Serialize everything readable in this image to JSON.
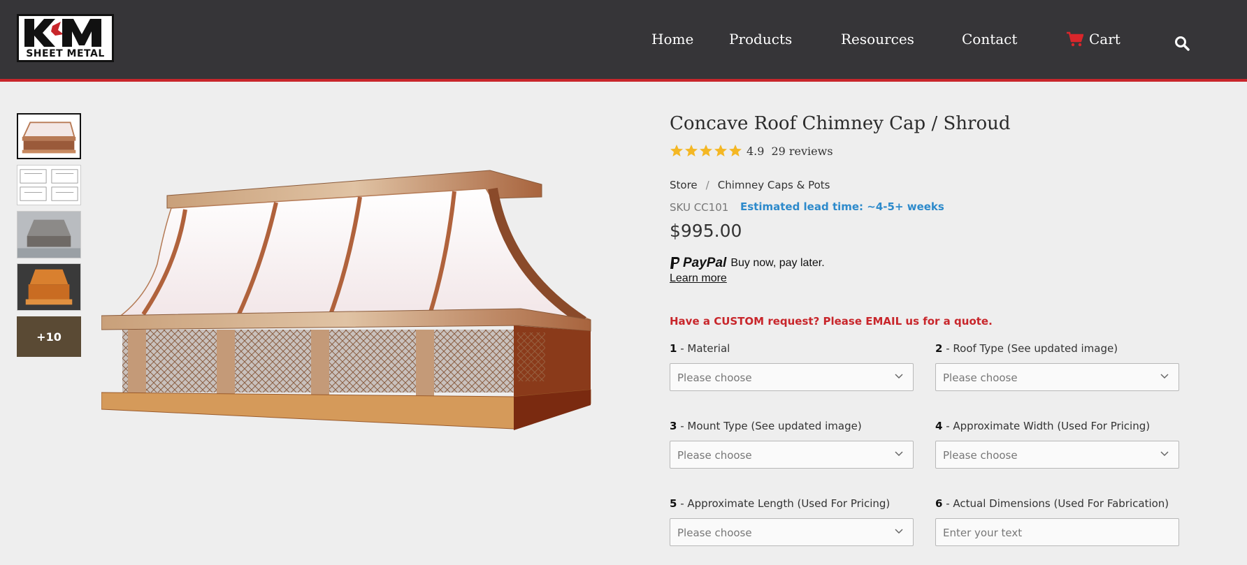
{
  "header": {
    "logo_text": "SHEET METAL",
    "logo_mark": "KM",
    "nav": [
      {
        "label": "Home"
      },
      {
        "label": "Products"
      },
      {
        "label": "Resources"
      },
      {
        "label": "Contact"
      },
      {
        "label": "Cart",
        "icon": "cart-icon"
      }
    ],
    "search_icon": "search-icon",
    "accent_color": "#c8262b",
    "bg_color": "#363538"
  },
  "gallery": {
    "more_label": "+10"
  },
  "product": {
    "title": "Concave Roof Chimney Cap / Shroud",
    "rating": "4.9",
    "reviews": "29 reviews",
    "stars": 5,
    "breadcrumb": [
      "Store",
      "/",
      "Chimney Caps & Pots"
    ],
    "sku": "SKU CC101",
    "lead_time": "Estimated lead time: ~4-5+ weeks",
    "price": "$995.00",
    "paypal_brand": "PayPal",
    "paypal_text": "Buy now, pay later.",
    "learn_more": "Learn more",
    "custom_note": "Have a CUSTOM request? Please EMAIL us for a quote."
  },
  "options": [
    {
      "num": "1",
      "label": "Material",
      "placeholder": "Please choose",
      "type": "select"
    },
    {
      "num": "2",
      "label": "Roof Type (See updated image)",
      "placeholder": "Please choose",
      "type": "select"
    },
    {
      "num": "3",
      "label": "Mount Type (See updated image)",
      "placeholder": "Please choose",
      "type": "select"
    },
    {
      "num": "4",
      "label": "Approximate Width (Used For Pricing)",
      "placeholder": "Please choose",
      "type": "select"
    },
    {
      "num": "5",
      "label": "Approximate Length (Used For Pricing)",
      "placeholder": "Please choose",
      "type": "select"
    },
    {
      "num": "6",
      "label": "Actual Dimensions (Used For Fabrication)",
      "placeholder": "Enter your text",
      "type": "text"
    }
  ]
}
